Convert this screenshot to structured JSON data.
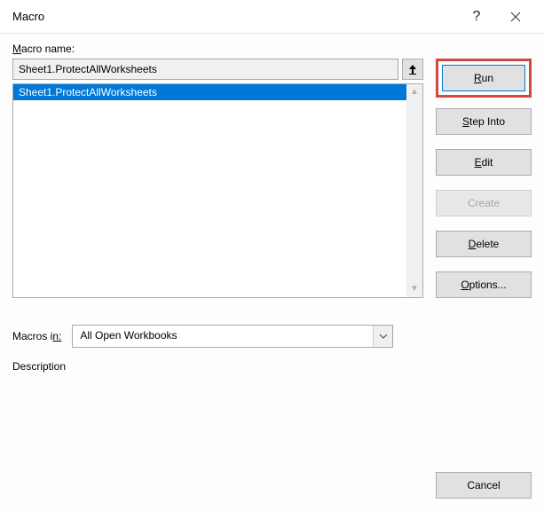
{
  "window": {
    "title": "Macro"
  },
  "labels": {
    "macro_name_prefix": "M",
    "macro_name_rest": "acro name:",
    "macros_in": "Macros i",
    "macros_in_suffix": "n:",
    "description": "Description"
  },
  "fields": {
    "macro_name_value": "Sheet1.ProtectAllWorksheets",
    "macros_in_value": "All Open Workbooks"
  },
  "list": {
    "items": [
      "Sheet1.ProtectAllWorksheets"
    ]
  },
  "buttons": {
    "run_u": "R",
    "run_rest": "un",
    "stepinto_u": "S",
    "stepinto_rest": "tep Into",
    "edit_u": "E",
    "edit_rest": "dit",
    "create": "Create",
    "delete_u": "D",
    "delete_rest": "elete",
    "options_u": "O",
    "options_rest": "ptions...",
    "cancel": "Cancel"
  }
}
